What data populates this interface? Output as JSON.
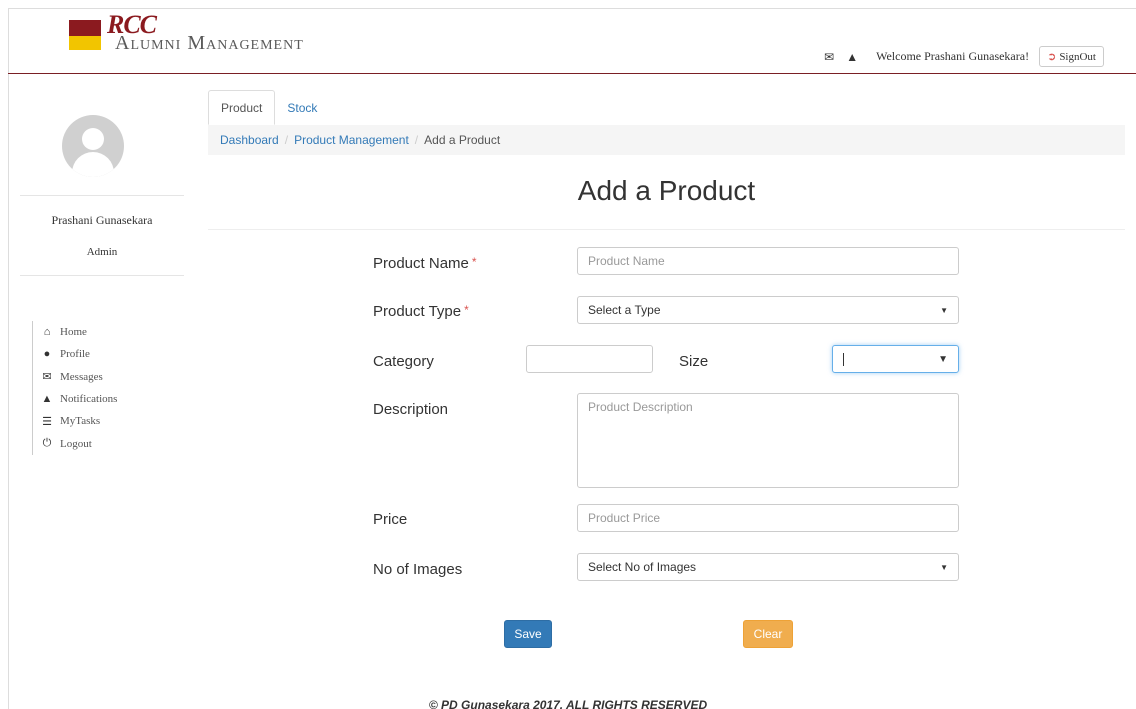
{
  "brand": {
    "logo_text": "RCC",
    "title": "Alumni Management",
    "colors": {
      "maroon": "#8b1a1f",
      "gold": "#f2c500"
    }
  },
  "header": {
    "icons": [
      "envelope-icon",
      "bell-icon"
    ],
    "welcome": "Welcome Prashani Gunasekara!",
    "signout_label": "SignOut"
  },
  "sidebar": {
    "user_name": "Prashani Gunasekara",
    "user_role": "Admin",
    "items": [
      {
        "label": "Home",
        "icon": "home-icon"
      },
      {
        "label": "Profile",
        "icon": "user-icon"
      },
      {
        "label": "Messages",
        "icon": "envelope-icon"
      },
      {
        "label": "Notifications",
        "icon": "bell-icon"
      },
      {
        "label": "MyTasks",
        "icon": "list-icon"
      },
      {
        "label": "Logout",
        "icon": "power-icon"
      }
    ]
  },
  "tabs": [
    {
      "label": "Product",
      "active": true
    },
    {
      "label": "Stock",
      "active": false
    }
  ],
  "breadcrumb": {
    "items": [
      "Dashboard",
      "Product Management"
    ],
    "current": "Add a Product",
    "separator": "/"
  },
  "page_title": "Add a Product",
  "form": {
    "product_name": {
      "label": "Product Name",
      "required_mark": "*",
      "placeholder": "Product Name"
    },
    "product_type": {
      "label": "Product Type",
      "required_mark": "*",
      "selected": "Select a Type"
    },
    "category": {
      "label": "Category",
      "value": ""
    },
    "size": {
      "label": "Size",
      "value": ""
    },
    "description": {
      "label": "Description",
      "placeholder": "Product Description"
    },
    "price": {
      "label": "Price",
      "placeholder": "Product Price"
    },
    "images": {
      "label": "No of Images",
      "selected": "Select No of Images"
    },
    "save_label": "Save",
    "clear_label": "Clear"
  },
  "footer": "© PD Gunasekara 2017. ALL RIGHTS RESERVED"
}
